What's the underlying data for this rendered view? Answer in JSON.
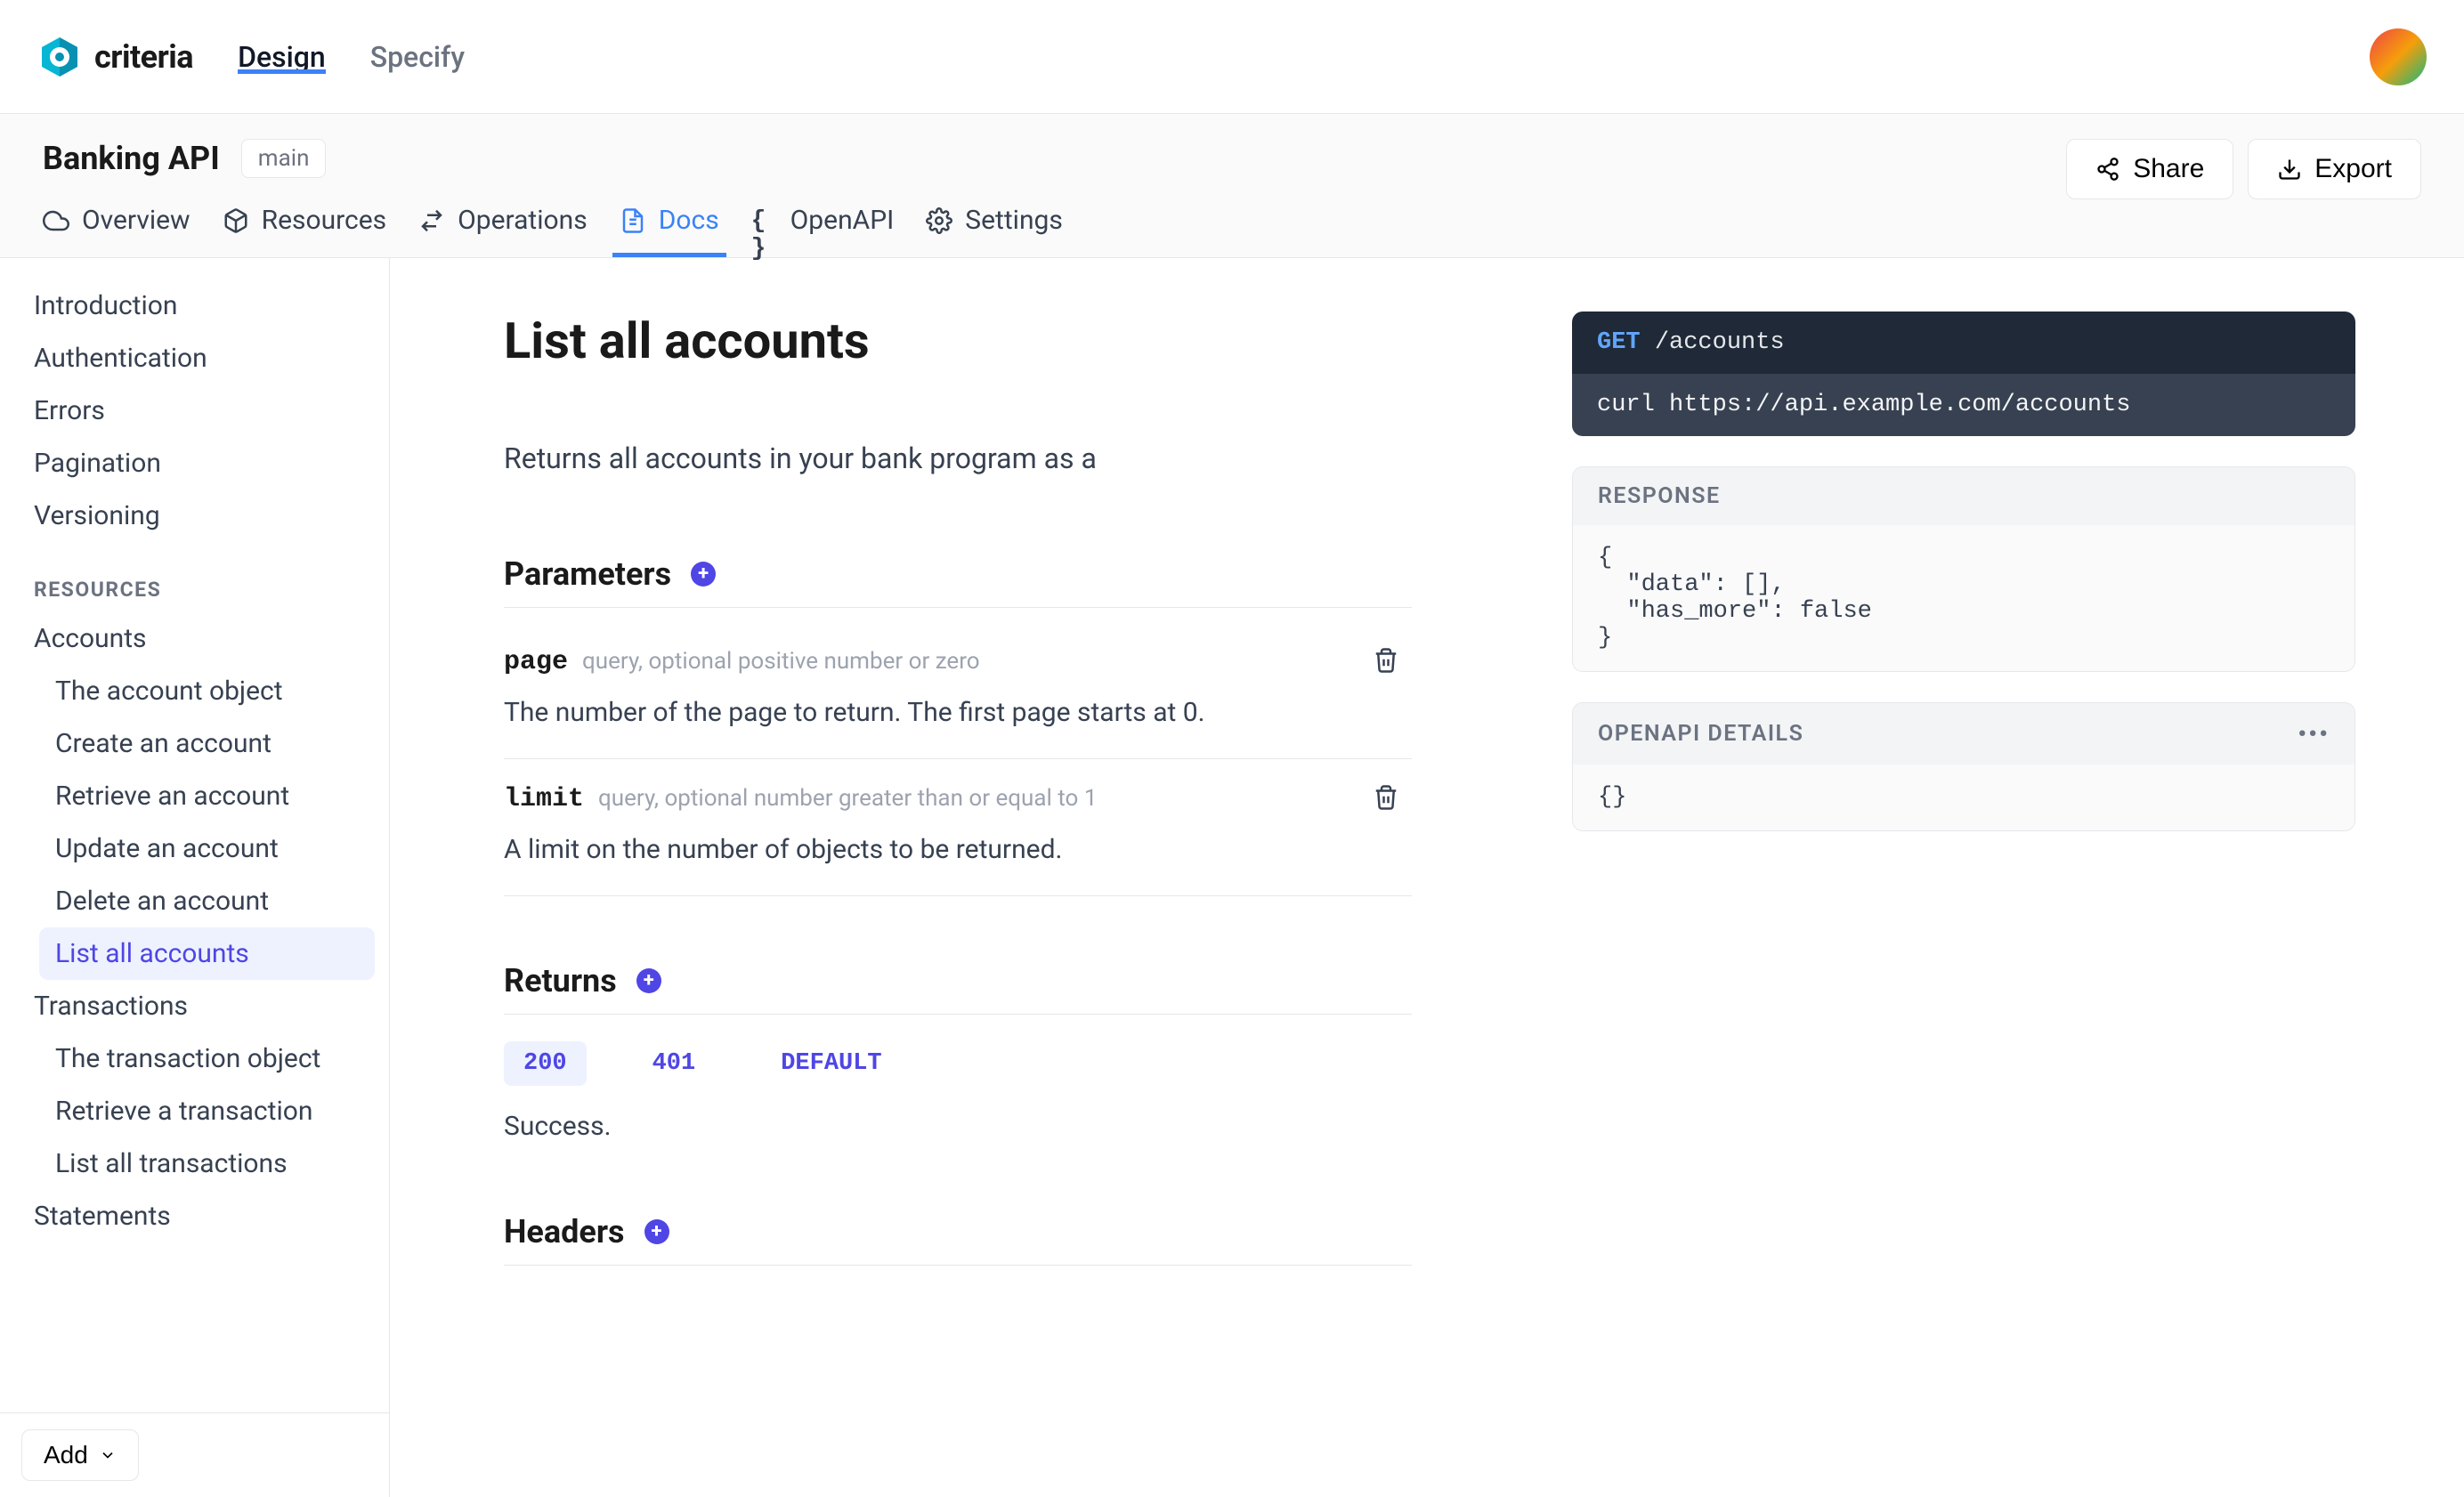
{
  "brand": "criteria",
  "top_tabs": {
    "design": "Design",
    "specify": "Specify"
  },
  "api_title": "Banking API",
  "branch": "main",
  "actions": {
    "share": "Share",
    "export": "Export"
  },
  "nav_tabs": {
    "overview": "Overview",
    "resources": "Resources",
    "operations": "Operations",
    "docs": "Docs",
    "openapi": "OpenAPI",
    "settings": "Settings"
  },
  "sidebar": {
    "top": [
      "Introduction",
      "Authentication",
      "Errors",
      "Pagination",
      "Versioning"
    ],
    "section_label": "RESOURCES",
    "accounts_label": "Accounts",
    "accounts": [
      "The account object",
      "Create an account",
      "Retrieve an account",
      "Update an account",
      "Delete an account",
      "List all accounts"
    ],
    "transactions_label": "Transactions",
    "transactions": [
      "The transaction object",
      "Retrieve a transaction",
      "List all transactions"
    ],
    "statements_label": "Statements",
    "add_button": "Add"
  },
  "doc": {
    "title": "List all accounts",
    "description": "Returns all accounts in your bank program as a",
    "parameters_heading": "Parameters",
    "params": [
      {
        "name": "page",
        "type": "query, optional positive number or zero",
        "desc": "The number of the page to return. The first page starts at 0."
      },
      {
        "name": "limit",
        "type": "query, optional number greater than or equal to 1",
        "desc": "A limit on the number of objects to be returned."
      }
    ],
    "returns_heading": "Returns",
    "return_codes": [
      "200",
      "401",
      "DEFAULT"
    ],
    "return_desc": "Success.",
    "headers_heading": "Headers"
  },
  "api_example": {
    "method": "GET",
    "path": "/accounts",
    "curl": "curl https://api.example.com/accounts"
  },
  "response": {
    "label": "RESPONSE",
    "body": "{\n  \"data\": [],\n  \"has_more\": false\n}"
  },
  "openapi_panel": {
    "label": "OPENAPI DETAILS",
    "body": "{}"
  }
}
